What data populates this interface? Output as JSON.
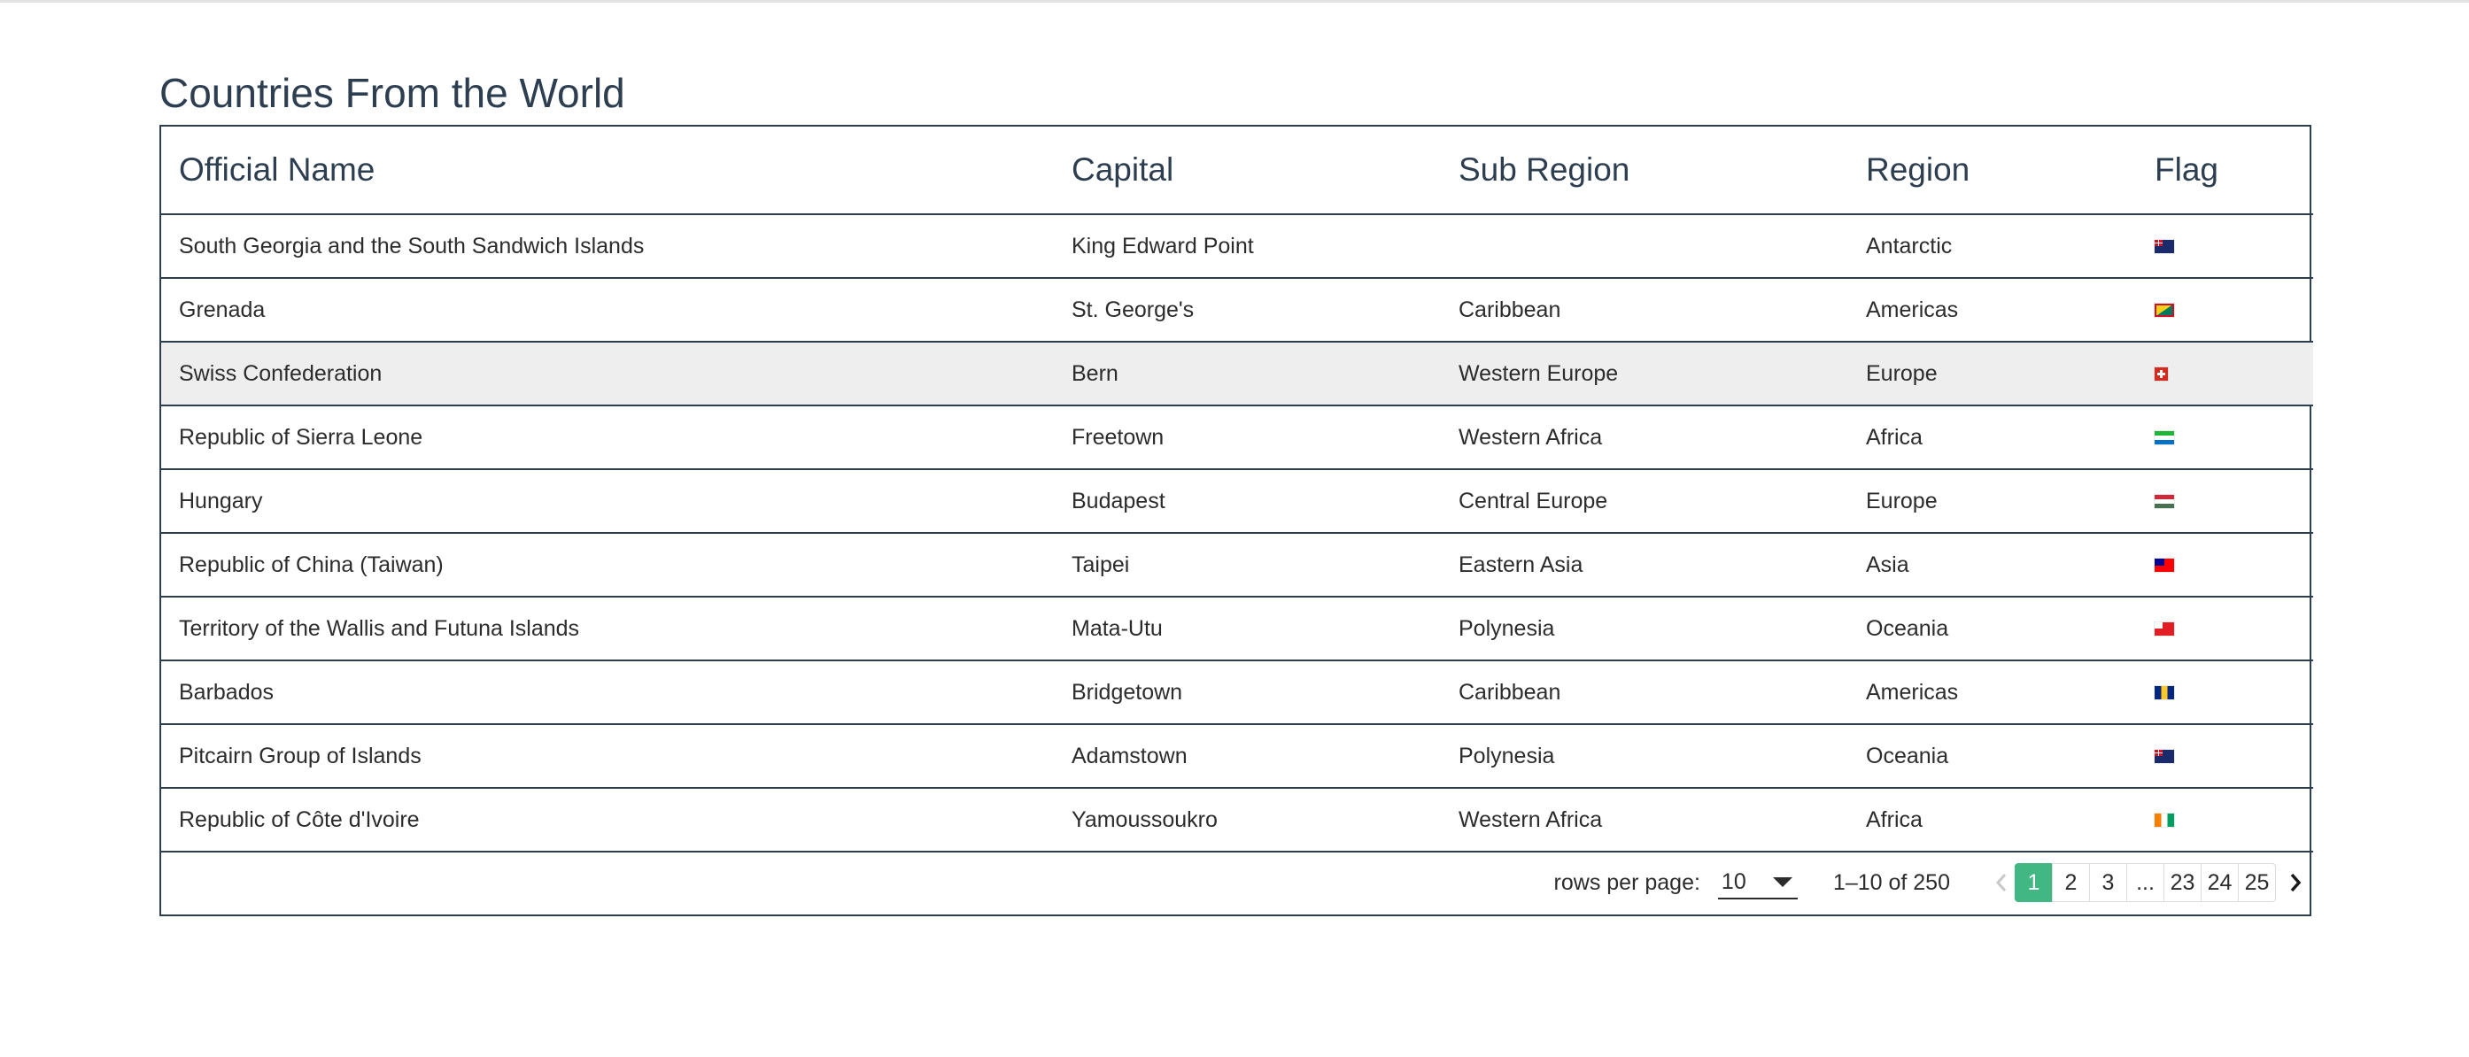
{
  "page": {
    "title": "Countries From the World"
  },
  "table": {
    "headers": [
      "Official Name",
      "Capital",
      "Sub Region",
      "Region",
      "Flag"
    ],
    "rows": [
      {
        "name": "South Georgia and the South Sandwich Islands",
        "capital": "King Edward Point",
        "subregion": "",
        "region": "Antarctic",
        "flag_icon": "flag-south-georgia-icon"
      },
      {
        "name": "Grenada",
        "capital": "St. George's",
        "subregion": "Caribbean",
        "region": "Americas",
        "flag_icon": "flag-grenada-icon"
      },
      {
        "name": "Swiss Confederation",
        "capital": "Bern",
        "subregion": "Western Europe",
        "region": "Europe",
        "flag_icon": "flag-switzerland-icon",
        "highlighted": true
      },
      {
        "name": "Republic of Sierra Leone",
        "capital": "Freetown",
        "subregion": "Western Africa",
        "region": "Africa",
        "flag_icon": "flag-sierra-leone-icon"
      },
      {
        "name": "Hungary",
        "capital": "Budapest",
        "subregion": "Central Europe",
        "region": "Europe",
        "flag_icon": "flag-hungary-icon"
      },
      {
        "name": "Republic of China (Taiwan)",
        "capital": "Taipei",
        "subregion": "Eastern Asia",
        "region": "Asia",
        "flag_icon": "flag-taiwan-icon"
      },
      {
        "name": "Territory of the Wallis and Futuna Islands",
        "capital": "Mata-Utu",
        "subregion": "Polynesia",
        "region": "Oceania",
        "flag_icon": "flag-wallis-futuna-icon"
      },
      {
        "name": "Barbados",
        "capital": "Bridgetown",
        "subregion": "Caribbean",
        "region": "Americas",
        "flag_icon": "flag-barbados-icon"
      },
      {
        "name": "Pitcairn Group of Islands",
        "capital": "Adamstown",
        "subregion": "Polynesia",
        "region": "Oceania",
        "flag_icon": "flag-pitcairn-icon"
      },
      {
        "name": "Republic of Côte d'Ivoire",
        "capital": "Yamoussoukro",
        "subregion": "Western Africa",
        "region": "Africa",
        "flag_icon": "flag-ivory-coast-icon"
      }
    ]
  },
  "pagination": {
    "rows_per_page_label": "rows per page:",
    "rows_per_page_value": "10",
    "range_text": "1–10 of 250",
    "pages": [
      "1",
      "2",
      "3",
      "...",
      "23",
      "24",
      "25"
    ],
    "active_page": "1"
  },
  "colors": {
    "title": "#2c3e50",
    "border": "#2c3e50",
    "active_page": "#41b883",
    "row_highlight": "#eeeeee"
  }
}
